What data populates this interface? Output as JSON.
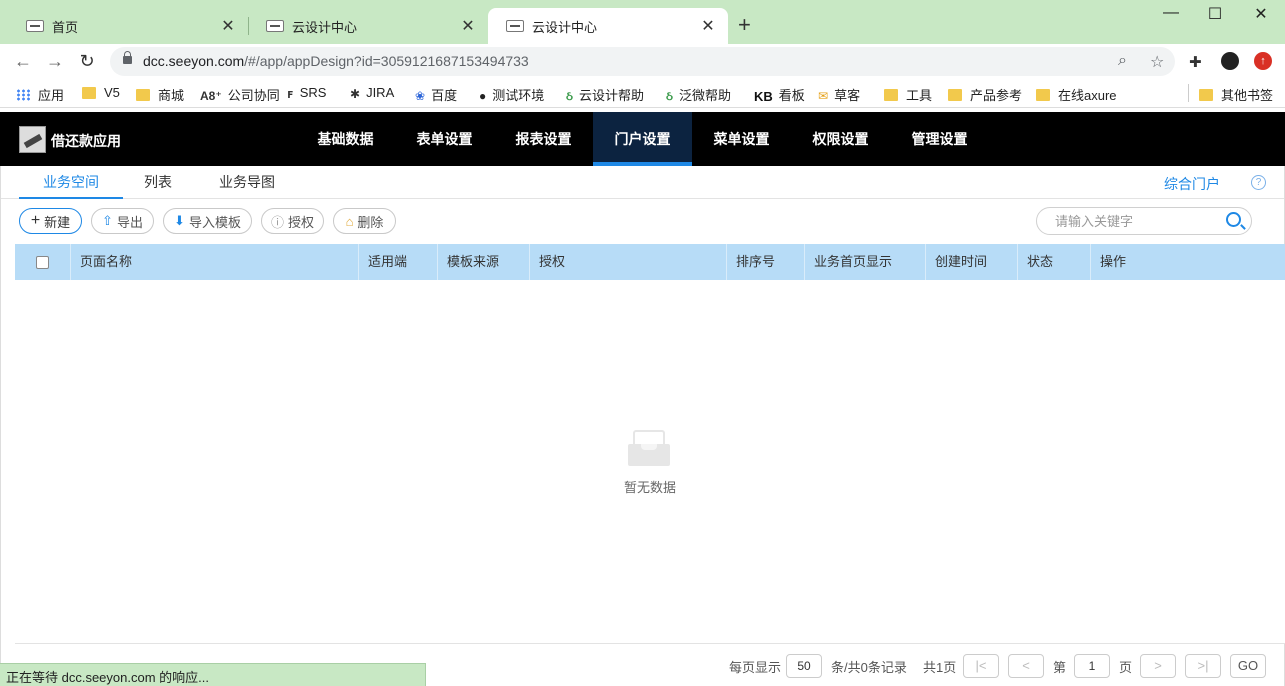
{
  "browser": {
    "tabs": [
      {
        "title": "首页",
        "close": "✕"
      },
      {
        "title": "云设计中心",
        "close": "✕"
      },
      {
        "title": "云设计中心",
        "close": "✕"
      }
    ],
    "new_tab": "+",
    "window_controls": {
      "minimize": "—",
      "maximize": "☐",
      "close": "✕"
    },
    "url_main": "dcc.seeyon.com",
    "url_rest": "/#/app/appDesign?id=3059121687153494733",
    "bookmarks": [
      {
        "label": "应用",
        "icon": "apps-grid-icon"
      },
      {
        "label": "V5",
        "icon": "folder-icon"
      },
      {
        "label": "商城",
        "icon": "folder-icon"
      },
      {
        "label": "公司协同",
        "icon": "a8-icon",
        "glyph": "A8⁺"
      },
      {
        "label": "SRS",
        "icon": "axure-icon",
        "glyph": "ꜰ"
      },
      {
        "label": "JIRA",
        "icon": "jira-icon",
        "glyph": "✱"
      },
      {
        "label": "百度",
        "icon": "baidu-paw-icon",
        "glyph": "❀"
      },
      {
        "label": "测试环境",
        "icon": "globe-icon",
        "glyph": "●"
      },
      {
        "label": "云设计帮助",
        "icon": "seeyon-icon",
        "glyph": "ઠ"
      },
      {
        "label": "泛微帮助",
        "icon": "seeyon-icon",
        "glyph": "ઠ"
      },
      {
        "label": "看板",
        "icon": "kb-icon",
        "glyph": "KB"
      },
      {
        "label": "草客",
        "icon": "mail-icon",
        "glyph": "✉"
      },
      {
        "label": "工具",
        "icon": "folder-icon"
      },
      {
        "label": "产品参考",
        "icon": "folder-icon"
      },
      {
        "label": "在线axure",
        "icon": "folder-icon"
      }
    ],
    "other_bookmarks": "其他书签",
    "status": "正在等待 dcc.seeyon.com 的响应..."
  },
  "app": {
    "name": "借还款应用",
    "nav": [
      "基础数据",
      "表单设置",
      "报表设置",
      "门户设置",
      "菜单设置",
      "权限设置",
      "管理设置"
    ],
    "active_nav": "门户设置"
  },
  "subtabs": [
    "业务空间",
    "列表",
    "业务导图"
  ],
  "active_subtab": "业务空间",
  "portal_link": "综合门户",
  "help": "?",
  "actions": {
    "new": "新建",
    "export": "导出",
    "import_template": "导入模板",
    "authorize": "授权",
    "delete": "删除"
  },
  "search": {
    "placeholder": "请输入关键字",
    "value": ""
  },
  "table": {
    "columns": [
      "页面名称",
      "适用端",
      "模板来源",
      "授权",
      "排序号",
      "业务首页显示",
      "创建时间",
      "状态",
      "操作"
    ],
    "rows": [],
    "empty_text": "暂无数据"
  },
  "pager": {
    "per_page_label": "每页显示",
    "per_page": "50",
    "total_text": "条/共0条记录",
    "pages_text": "共1页",
    "page_prefix": "第",
    "page": "1",
    "page_suffix": "页",
    "go": "GO"
  },
  "colors": {
    "accent": "#1e88e5",
    "appbar": "#000000",
    "active_nav_bg": "#0c2340",
    "table_header": "#b7dcf7",
    "chrome": "#c8e8c4"
  }
}
